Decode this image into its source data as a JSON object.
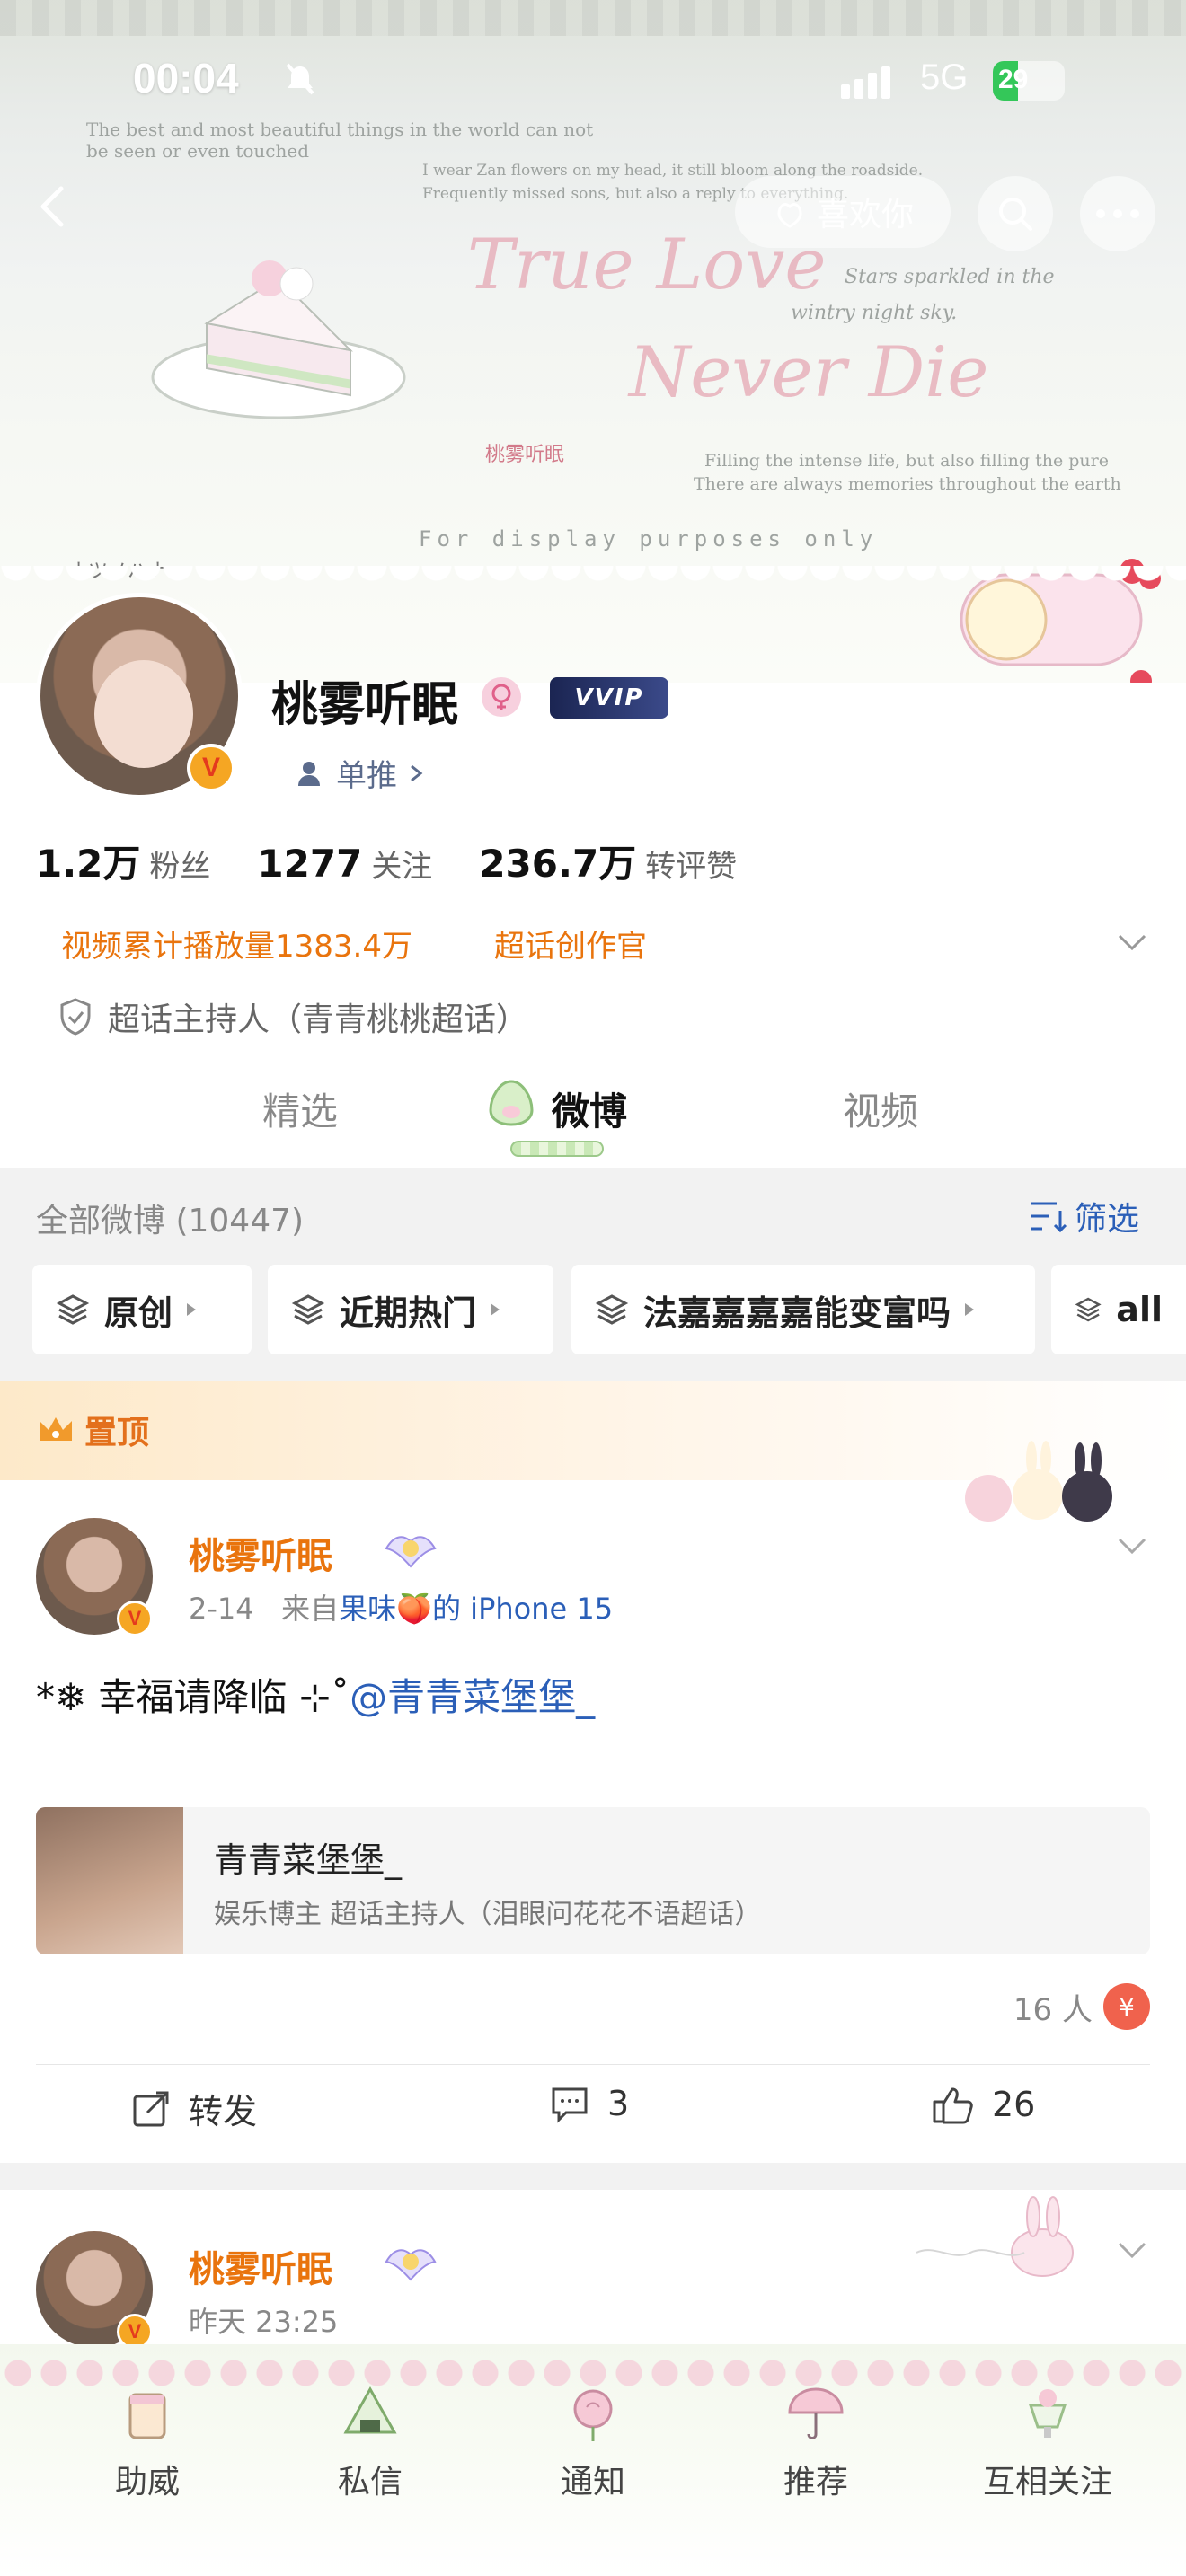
{
  "status_bar": {
    "time": "00:04",
    "network": "5G",
    "battery": "29"
  },
  "banner": {
    "like_button": "喜欢你",
    "decor_lines": [
      "The best and most beautiful things in the world can not",
      "be seen or even touched",
      "I wear Zan flowers on my head, it still bloom along the roadside.",
      "Frequently missed sons, but also a reply to everything.",
      "Stars sparkled in the",
      "wintry night sky.",
      "Filling the intense life, but also filling the pure",
      "There are always memories throughout the earth",
      "For display purposes only",
      "桃雾听眠",
      "ナツノハナ"
    ],
    "script_1": "True Love",
    "script_2": "Never Die"
  },
  "profile": {
    "name": "桃雾听眠",
    "vip_label": "VVIP",
    "fan_tag": "单推",
    "stats": [
      {
        "num": "1.2万",
        "label": "粉丝"
      },
      {
        "num": "1277",
        "label": "关注"
      },
      {
        "num": "236.7万",
        "label": "转评赞"
      }
    ],
    "video_plays": "视频累计播放量1383.4万",
    "creator_tag": "超话创作官",
    "host_line": "超话主持人（青青桃桃超话）"
  },
  "tabs": [
    {
      "label": "精选"
    },
    {
      "label": "微博"
    },
    {
      "label": "视频"
    }
  ],
  "feed": {
    "count_label": "全部微博 (10447)",
    "filter_label": "筛选",
    "chips": [
      "原创",
      "近期热门",
      "法嘉嘉嘉嘉能变富吗",
      "all"
    ],
    "pinned_label": "置顶",
    "post1": {
      "author": "桃雾听眠",
      "date": "2-14",
      "from_prefix": "来自",
      "source": "果味🍑的 iPhone 15",
      "text_prefix": "*❄ 幸福请降临 ⊹˚",
      "mention": "@青青菜堡堡_",
      "quote_title": "青青菜堡堡_",
      "quote_sub": "娱乐博主 超话主持人（泪眼问花花不语超话）",
      "people": "16 人",
      "repost": "转发",
      "comments": "3",
      "likes": "26"
    },
    "post2": {
      "author": "桃雾听眠",
      "date": "昨天 23:25"
    }
  },
  "bottom_tabs": [
    "助威",
    "私信",
    "通知",
    "推荐",
    "互相关注"
  ],
  "colors": {
    "accent_orange": "#e9740d",
    "link_blue": "#2b5fb8",
    "vip_navy": "#1b2552"
  }
}
